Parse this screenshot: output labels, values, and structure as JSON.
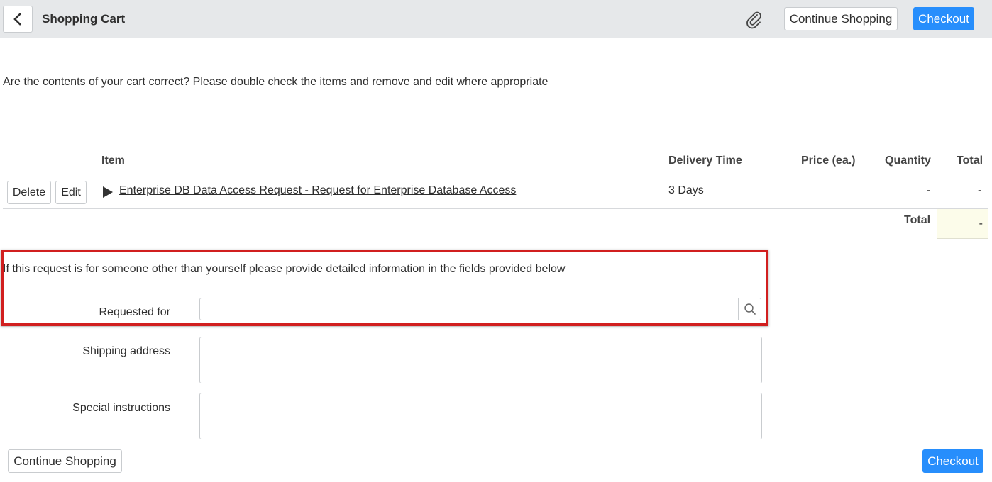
{
  "header": {
    "title": "Shopping Cart",
    "continue_label": "Continue Shopping",
    "checkout_label": "Checkout",
    "back_icon": "chevron-left-icon",
    "attach_icon": "paperclip-icon"
  },
  "intro": "Are the contents of your cart correct? Please double check the items and remove and edit where appropriate",
  "table": {
    "headers": {
      "item": "Item",
      "delivery": "Delivery Time",
      "price": "Price (ea.)",
      "quantity": "Quantity",
      "total": "Total"
    },
    "rows": [
      {
        "delete_label": "Delete",
        "edit_label": "Edit",
        "item": "Enterprise DB Data Access Request - Request for Enterprise Database Access",
        "delivery": "3 Days",
        "price": "",
        "quantity": "-",
        "total": "-"
      }
    ],
    "grand_total_label": "Total",
    "grand_total_value": "-"
  },
  "form": {
    "note": "If this request is for someone other than yourself please provide detailed information in the fields provided below",
    "requested_for_label": "Requested for",
    "requested_for_value": "",
    "shipping_label": "Shipping address",
    "shipping_value": "",
    "special_label": "Special instructions",
    "special_value": ""
  },
  "footer": {
    "continue_label": "Continue Shopping",
    "checkout_label": "Checkout"
  },
  "colors": {
    "primary": "#278efc",
    "highlight": "#d11f1f",
    "header_bg": "#e6e8ea"
  }
}
